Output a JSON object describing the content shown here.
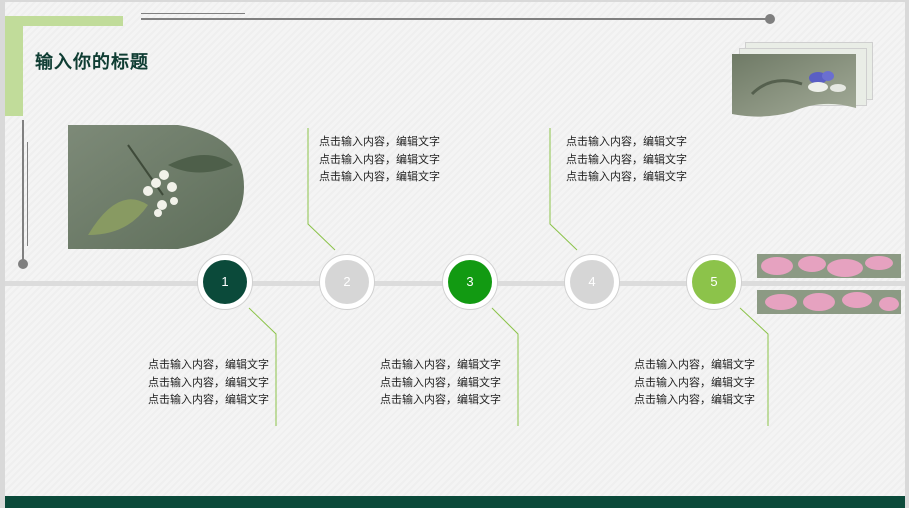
{
  "title": "输入你的标题",
  "steps": [
    {
      "number": "1",
      "color": "#0b4a3a"
    },
    {
      "number": "2",
      "color": "#d6d6d6"
    },
    {
      "number": "3",
      "color": "#129a12"
    },
    {
      "number": "4",
      "color": "#d6d6d6"
    },
    {
      "number": "5",
      "color": "#8cc34a"
    }
  ],
  "text_blocks": [
    {
      "lines": [
        "点击输入内容，编辑文字",
        "点击输入内容，编辑文字",
        "点击输入内容，编辑文字"
      ]
    },
    {
      "lines": [
        "点击输入内容，编辑文字",
        "点击输入内容，编辑文字",
        "点击输入内容，编辑文字"
      ]
    },
    {
      "lines": [
        "点击输入内容，编辑文字",
        "点击输入内容，编辑文字",
        "点击输入内容，编辑文字"
      ]
    },
    {
      "lines": [
        "点击输入内容，编辑文字",
        "点击输入内容，编辑文字",
        "点击输入内容，编辑文字"
      ]
    },
    {
      "lines": [
        "点击输入内容，编辑文字",
        "点击输入内容，编辑文字",
        "点击输入内容，编辑文字"
      ]
    }
  ],
  "colors": {
    "accent_green": "#c1dc9a",
    "dark_green": "#0b4a3a",
    "line_green": "#8cc34a"
  }
}
